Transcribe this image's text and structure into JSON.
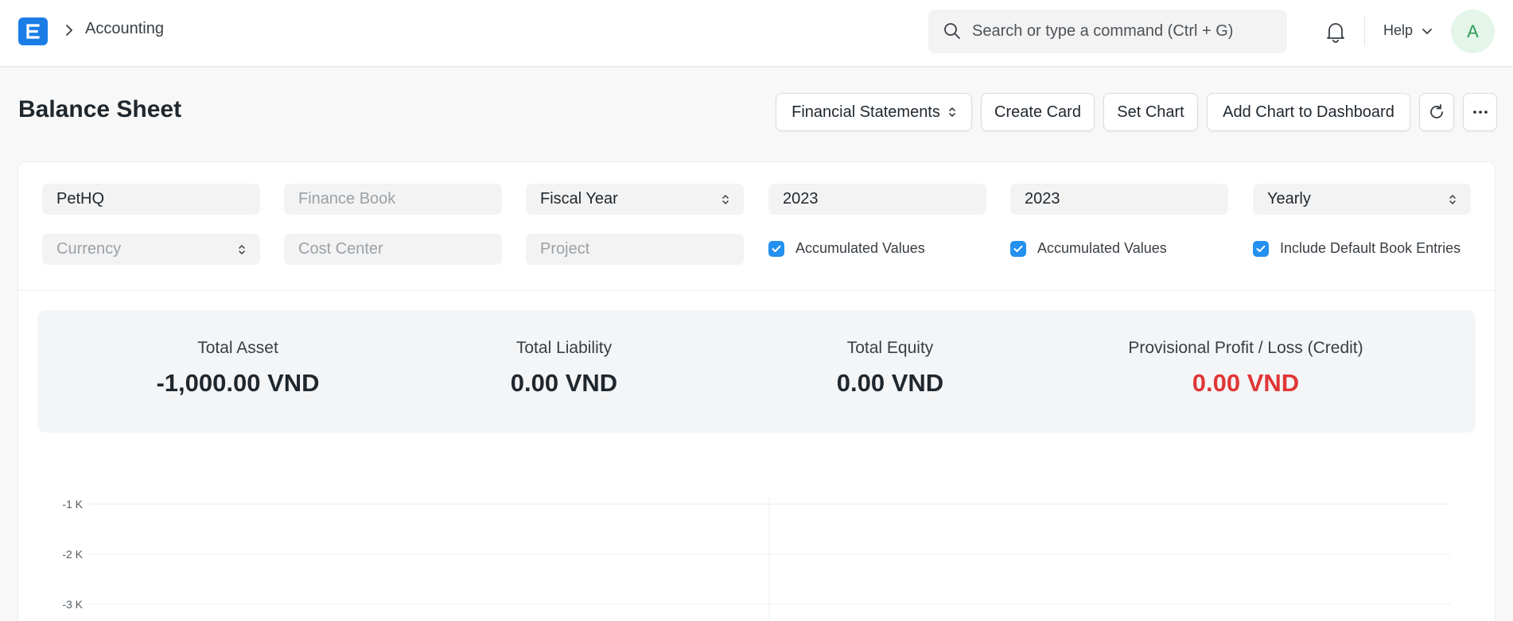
{
  "navbar": {
    "breadcrumb": "Accounting",
    "search_placeholder": "Search or type a command (Ctrl + G)",
    "help_label": "Help",
    "avatar_initial": "A"
  },
  "page": {
    "title": "Balance Sheet",
    "actions": {
      "financial_statements": "Financial Statements",
      "create_card": "Create Card",
      "set_chart": "Set Chart",
      "add_chart": "Add Chart to Dashboard"
    }
  },
  "filters": {
    "company": "PetHQ",
    "finance_book": "Finance Book",
    "filter_based_on": "Fiscal Year",
    "from_fiscal_year": "2023",
    "to_fiscal_year": "2023",
    "periodicity": "Yearly",
    "currency": "Currency",
    "cost_center": "Cost Center",
    "project": "Project",
    "check_1": "Accumulated Values",
    "check_2": "Accumulated Values",
    "check_3": "Include Default Book Entries"
  },
  "summary": [
    {
      "label": "Total Asset",
      "value": "-1,000.00 VND"
    },
    {
      "label": "Total Liability",
      "value": "0.00 VND"
    },
    {
      "label": "Total Equity",
      "value": "0.00 VND"
    },
    {
      "label": "Provisional Profit / Loss (Credit)",
      "value": "0.00 VND"
    }
  ],
  "chart_data": {
    "type": "bar",
    "y_ticks": [
      "-1 K",
      "-2 K",
      "-3 K"
    ]
  },
  "colors": {
    "primary": "#2490ef",
    "negative": "#e03636",
    "logo": "#1a7de6"
  }
}
